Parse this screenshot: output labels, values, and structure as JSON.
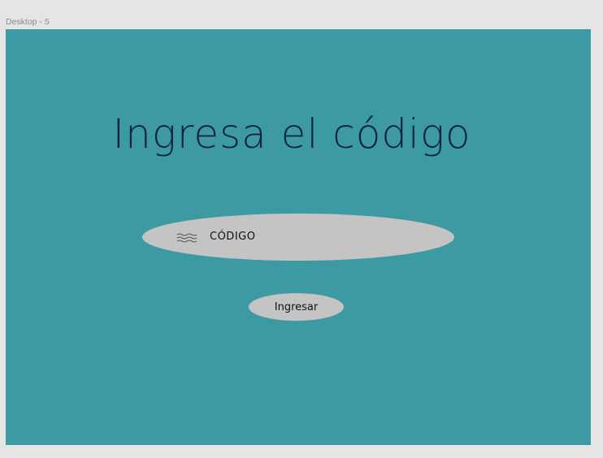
{
  "frame": {
    "label": "Desktop - 5"
  },
  "screen": {
    "title": "Ingresa el código",
    "code_input": {
      "placeholder": "CÓDIGO",
      "icon": "wavy-lines-icon"
    },
    "submit_label": "Ingresar"
  },
  "colors": {
    "canvas_background": "#e5e5e5",
    "artboard_background": "#3d9aa3",
    "title_text": "#102540",
    "control_fill": "#c4c4c4"
  }
}
